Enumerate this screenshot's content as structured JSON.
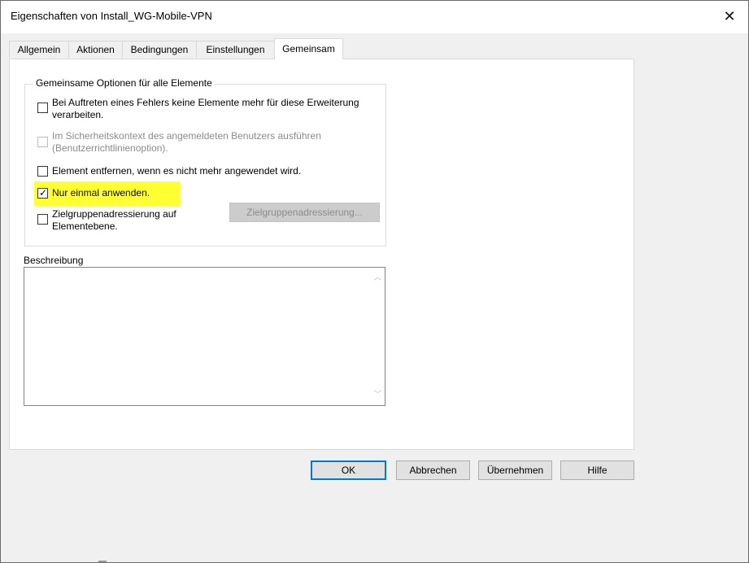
{
  "window": {
    "title": "Eigenschaften von Install_WG-Mobile-VPN",
    "close_glyph": "✕"
  },
  "tabs": [
    {
      "label": "Allgemein",
      "active": false
    },
    {
      "label": "Aktionen",
      "active": false
    },
    {
      "label": "Bedingungen",
      "active": false
    },
    {
      "label": "Einstellungen",
      "active": false
    },
    {
      "label": "Gemeinsam",
      "active": true
    }
  ],
  "group": {
    "legend": "Gemeinsame Optionen für alle Elemente",
    "options": [
      {
        "label": "Bei Auftreten eines Fehlers keine Elemente mehr für diese Erweiterung verarbeiten.",
        "checked": false,
        "enabled": true
      },
      {
        "label": "Im Sicherheitskontext des angemeldeten Benutzers ausführen (Benutzerrichtlinienoption).",
        "checked": false,
        "enabled": false
      },
      {
        "label": "Element entfernen, wenn es nicht mehr angewendet wird.",
        "checked": false,
        "enabled": true
      },
      {
        "label": "Nur einmal anwenden.",
        "checked": true,
        "enabled": true,
        "highlight": "#ffff32"
      },
      {
        "label": "Zielgruppenadressierung auf Elementebene.",
        "checked": false,
        "enabled": true
      }
    ],
    "targeting_button": "Zielgruppenadressierung...",
    "check_glyph": "✓"
  },
  "description": {
    "label": "Beschreibung",
    "value": ""
  },
  "buttons": {
    "ok": "OK",
    "cancel": "Abbrechen",
    "apply": "Übernehmen",
    "help": "Hilfe"
  },
  "colors": {
    "accent": "#0078d7",
    "highlight": "#ffff32"
  }
}
